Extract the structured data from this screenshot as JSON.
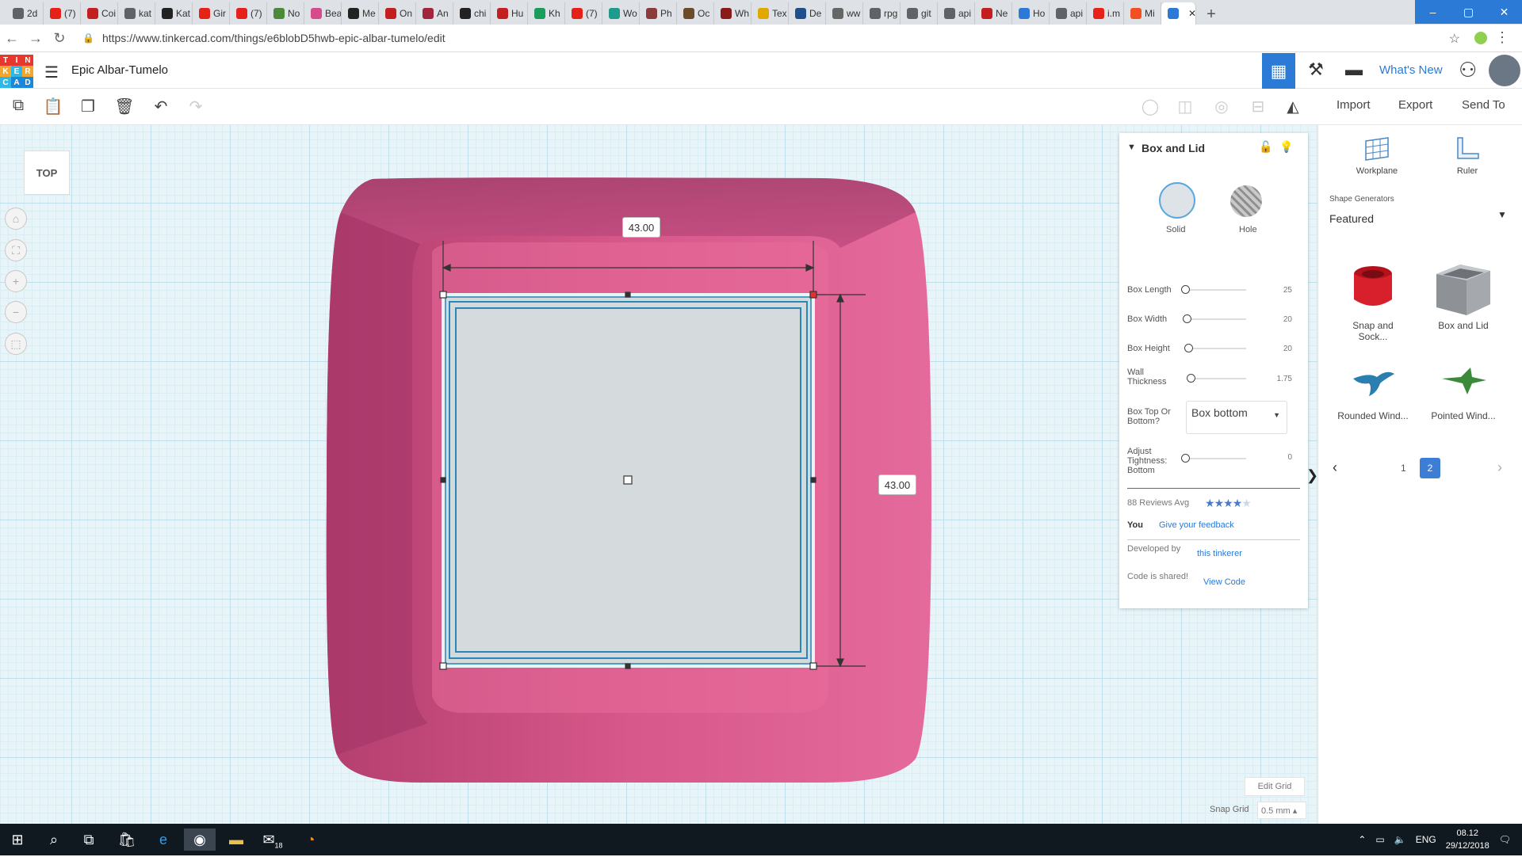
{
  "browser": {
    "tabs": [
      {
        "label": "2d",
        "color": "#5f6368"
      },
      {
        "label": "(7)",
        "color": "#e62117"
      },
      {
        "label": "Coi",
        "color": "#c41f1f"
      },
      {
        "label": "kat",
        "color": "#5f6368"
      },
      {
        "label": "Kat",
        "color": "#222222"
      },
      {
        "label": "Gir",
        "color": "#e62117"
      },
      {
        "label": "(7)",
        "color": "#e62117"
      },
      {
        "label": "No",
        "color": "#4a8a3a"
      },
      {
        "label": "Bea",
        "color": "#d64b8a"
      },
      {
        "label": "Me",
        "color": "#222222"
      },
      {
        "label": "On",
        "color": "#c41f1f"
      },
      {
        "label": "An",
        "color": "#a1253d"
      },
      {
        "label": "chi",
        "color": "#222222"
      },
      {
        "label": "Hu",
        "color": "#c41f1f"
      },
      {
        "label": "Kh",
        "color": "#1a9c5a"
      },
      {
        "label": "(7)",
        "color": "#e62117"
      },
      {
        "label": "Wo",
        "color": "#1e9b8a"
      },
      {
        "label": "Ph",
        "color": "#8c3b3b"
      },
      {
        "label": "Oc",
        "color": "#6b4b2a"
      },
      {
        "label": "Wh",
        "color": "#8b1a1a"
      },
      {
        "label": "Tex",
        "color": "#e0a800"
      },
      {
        "label": "De",
        "color": "#1f4f8a"
      },
      {
        "label": "ww",
        "color": "#666666"
      },
      {
        "label": "rpg",
        "color": "#5f6368"
      },
      {
        "label": "git",
        "color": "#5f6368"
      },
      {
        "label": "api",
        "color": "#5f6368"
      },
      {
        "label": "Ne",
        "color": "#c41f1f"
      },
      {
        "label": "Ho",
        "color": "#2b7ad6"
      },
      {
        "label": "api",
        "color": "#5f6368"
      },
      {
        "label": "i.m",
        "color": "#e62117"
      },
      {
        "label": "Mi",
        "color": "#f25022"
      },
      {
        "label": "",
        "color": "#2b7ad6"
      }
    ],
    "close_tab": "✕",
    "new_tab": "+",
    "url": "https://www.tinkercad.com/things/e6blobD5hwb-epic-albar-tumelo/edit"
  },
  "app": {
    "logo_letters": [
      "T",
      "I",
      "N",
      "K",
      "E",
      "R",
      "C",
      "A",
      "D"
    ],
    "logo_colors": [
      "#e8372c",
      "#e8372c",
      "#e8372c",
      "#f4a62a",
      "#2eb8e6",
      "#f4a62a",
      "#2eb8e6",
      "#1a88d8",
      "#1a88d8"
    ],
    "title": "Epic Albar-Tumelo",
    "whats_new": "What's New"
  },
  "toolbar": {
    "import": "Import",
    "export": "Export",
    "send_to": "Send To"
  },
  "canvas": {
    "view_label": "TOP",
    "dim_width": "43.00",
    "dim_depth": "43.00",
    "edit_grid": "Edit Grid",
    "snap_grid_label": "Snap Grid",
    "snap_grid_value": "0.5 mm ▴",
    "shape_color": "#d85a8c"
  },
  "inspector": {
    "title": "Box and Lid",
    "solid": "Solid",
    "hole": "Hole",
    "params": [
      {
        "label": "Box Length",
        "value": "25",
        "level": 0.0
      },
      {
        "label": "Box Width",
        "value": "20",
        "level": 0.03
      },
      {
        "label": "Box Height",
        "value": "20",
        "level": 0.06
      },
      {
        "label": "Wall Thickness",
        "value": "1.75",
        "level": 0.09
      }
    ],
    "box_top_label": "Box Top Or Bottom?",
    "box_top_value": "Box bottom",
    "tightness_label": "Adjust Tightness: Bottom",
    "tightness_value": "0",
    "reviews": "88 Reviews Avg",
    "rating": 4,
    "you": "You",
    "feedback": "Give your feedback",
    "developed_by": "Developed by",
    "developer": "this tinkerer",
    "code_shared": "Code is shared!",
    "view_code": "View Code"
  },
  "right_panel": {
    "workplane": "Workplane",
    "ruler": "Ruler",
    "shape_generators": "Shape Generators",
    "featured": "Featured",
    "shapes": [
      {
        "label": "Snap and Sock...",
        "color": "#d8202c"
      },
      {
        "label": "Box and Lid",
        "color": "#9a9ea4"
      },
      {
        "label": "Rounded Wind...",
        "color": "#2a7fb0"
      },
      {
        "label": "Pointed Wind...",
        "color": "#3a8a3a"
      }
    ],
    "page1": "1",
    "page2": "2"
  },
  "taskbar": {
    "lang": "ENG",
    "time": "08.12",
    "date": "29/12/2018",
    "mail_badge": "18"
  }
}
